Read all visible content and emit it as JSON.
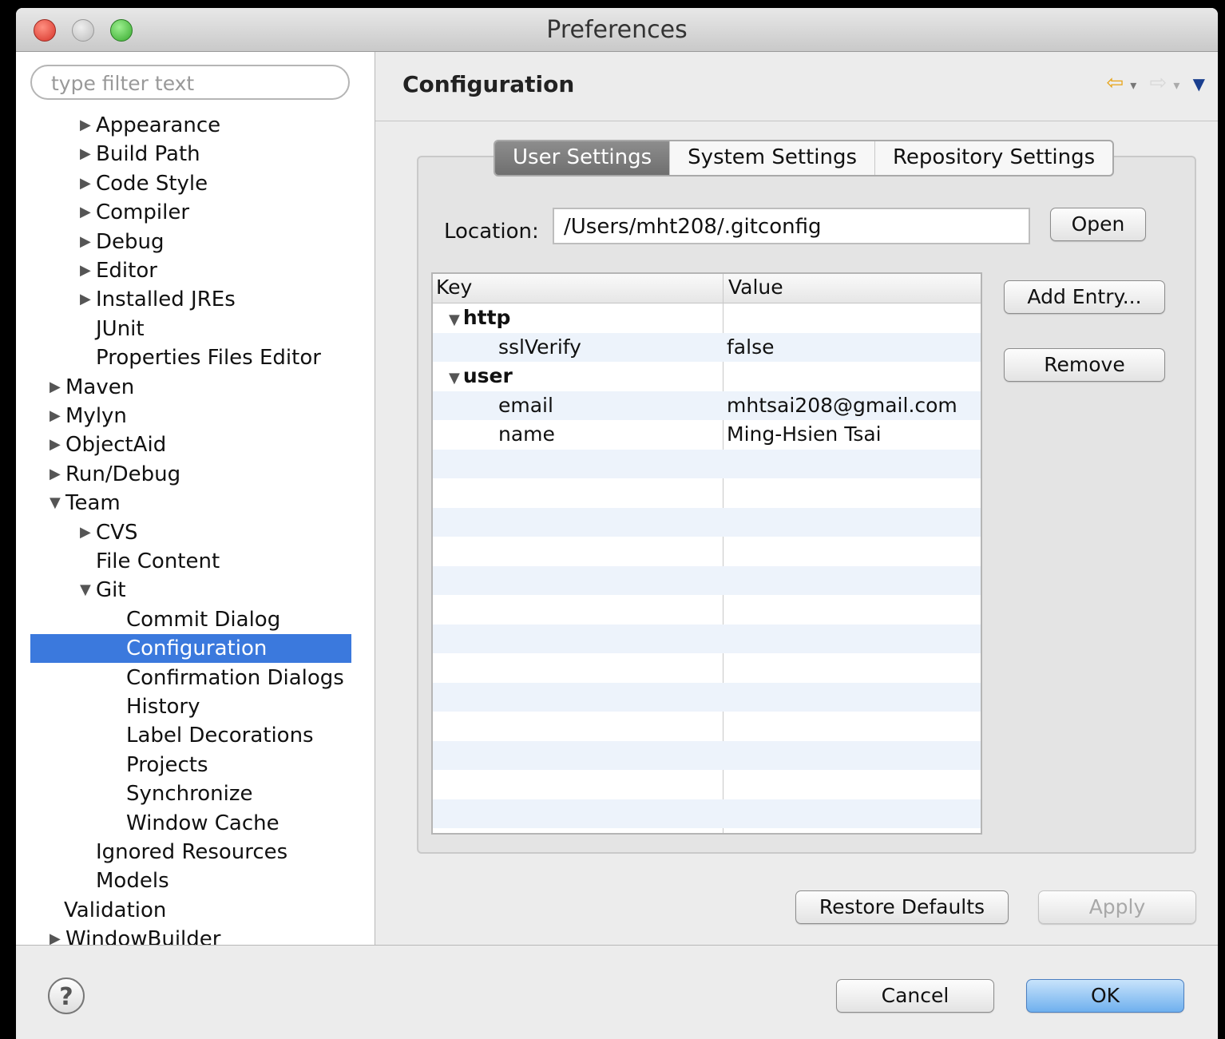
{
  "window": {
    "title": "Preferences"
  },
  "sidebar": {
    "filter_placeholder": "type filter text",
    "items": [
      {
        "label": "Appearance",
        "arrow": "▶"
      },
      {
        "label": "Build Path",
        "arrow": "▶"
      },
      {
        "label": "Code Style",
        "arrow": "▶"
      },
      {
        "label": "Compiler",
        "arrow": "▶"
      },
      {
        "label": "Debug",
        "arrow": "▶"
      },
      {
        "label": "Editor",
        "arrow": "▶"
      },
      {
        "label": "Installed JREs",
        "arrow": "▶"
      },
      {
        "label": "JUnit",
        "arrow": ""
      },
      {
        "label": "Properties Files Editor",
        "arrow": ""
      },
      {
        "label": "Maven",
        "arrow": "▶"
      },
      {
        "label": "Mylyn",
        "arrow": "▶"
      },
      {
        "label": "ObjectAid",
        "arrow": "▶"
      },
      {
        "label": "Run/Debug",
        "arrow": "▶"
      },
      {
        "label": "Team",
        "arrow": "▼"
      },
      {
        "label": "CVS",
        "arrow": "▶"
      },
      {
        "label": "File Content",
        "arrow": ""
      },
      {
        "label": "Git",
        "arrow": "▼"
      },
      {
        "label": "Commit Dialog",
        "arrow": ""
      },
      {
        "label": "Configuration",
        "arrow": ""
      },
      {
        "label": "Confirmation Dialogs",
        "arrow": ""
      },
      {
        "label": "History",
        "arrow": ""
      },
      {
        "label": "Label Decorations",
        "arrow": ""
      },
      {
        "label": "Projects",
        "arrow": ""
      },
      {
        "label": "Synchronize",
        "arrow": ""
      },
      {
        "label": "Window Cache",
        "arrow": ""
      },
      {
        "label": "Ignored Resources",
        "arrow": ""
      },
      {
        "label": "Models",
        "arrow": ""
      },
      {
        "label": "Validation",
        "arrow": ""
      },
      {
        "label": "WindowBuilder",
        "arrow": "▶"
      }
    ]
  },
  "main": {
    "title": "Configuration",
    "tabs": [
      {
        "label": "User Settings"
      },
      {
        "label": "System Settings"
      },
      {
        "label": "Repository Settings"
      }
    ],
    "location_label": "Location:",
    "location_value": "/Users/mht208/.gitconfig",
    "open_button": "Open",
    "add_entry_button": "Add Entry...",
    "remove_button": "Remove",
    "table": {
      "headers": [
        "Key",
        "Value"
      ],
      "rows": [
        {
          "key": "http",
          "value": "",
          "section": true,
          "arrow": "▼"
        },
        {
          "key": "sslVerify",
          "value": "false",
          "section": false,
          "arrow": ""
        },
        {
          "key": "user",
          "value": "",
          "section": true,
          "arrow": "▼"
        },
        {
          "key": "email",
          "value": "mhtsai208@gmail.com",
          "section": false,
          "arrow": ""
        },
        {
          "key": "name",
          "value": "Ming-Hsien Tsai",
          "section": false,
          "arrow": ""
        }
      ]
    },
    "restore_defaults_button": "Restore Defaults",
    "apply_button": "Apply"
  },
  "footer": {
    "help_icon": "?",
    "cancel_button": "Cancel",
    "ok_button": "OK"
  },
  "icons": {
    "back": "⇦",
    "forward": "⇨",
    "dropdown": "▾",
    "menu": "▼"
  },
  "colors": {
    "selection": "#3b79dd",
    "accent_ok": "#6fb0ee"
  }
}
